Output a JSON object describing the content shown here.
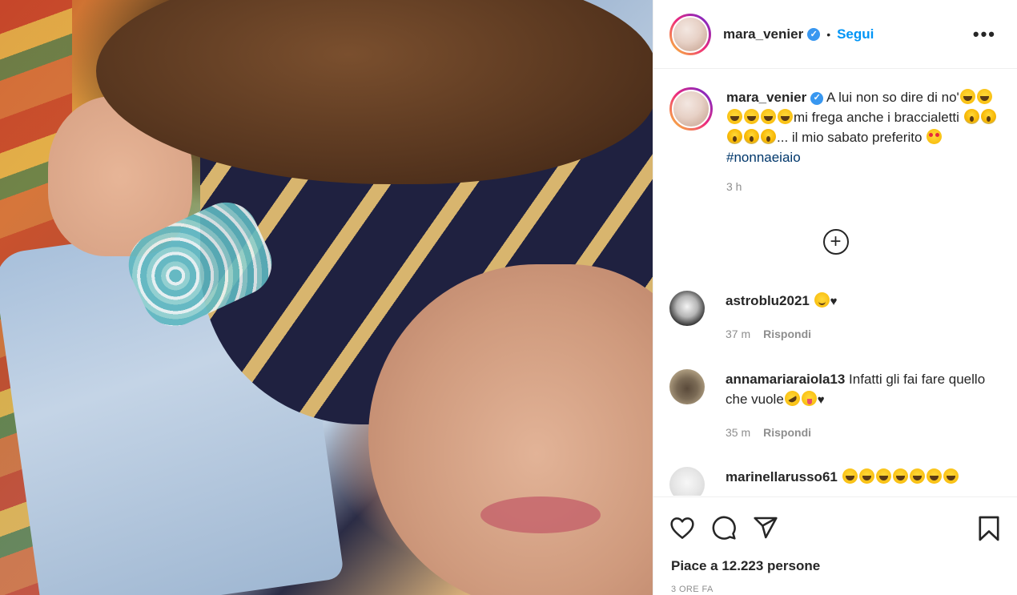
{
  "post": {
    "author": "mara_venier",
    "verified_icon": "verified-badge-icon",
    "dot": "•",
    "follow_label": "Segui",
    "more_icon": "•••"
  },
  "caption": {
    "username": "mara_venier",
    "text_1": "A lui non so dire di no'",
    "text_2": "mi frega anche i braccialetti",
    "text_3": "... il mio sabato preferito",
    "hashtag": "#nonnaeiaio",
    "time": "3 h"
  },
  "load_more_icon": "+",
  "comments": [
    {
      "username": "astroblu2021",
      "text": "",
      "time": "37 m",
      "reply": "Rispondi"
    },
    {
      "username": "annamariaraiola13",
      "text": "Infatti gli fai fare quello che vuole",
      "time": "35 m",
      "reply": "Rispondi"
    },
    {
      "username": "marinellarusso61",
      "text": "",
      "time": "",
      "reply": ""
    }
  ],
  "actions": {
    "likes": "Piace a 12.223 persone",
    "post_time": "3 ORE FA"
  },
  "colors": {
    "link": "#0095f6",
    "hashtag": "#00376b",
    "muted": "#8e8e8e",
    "text": "#262626"
  }
}
